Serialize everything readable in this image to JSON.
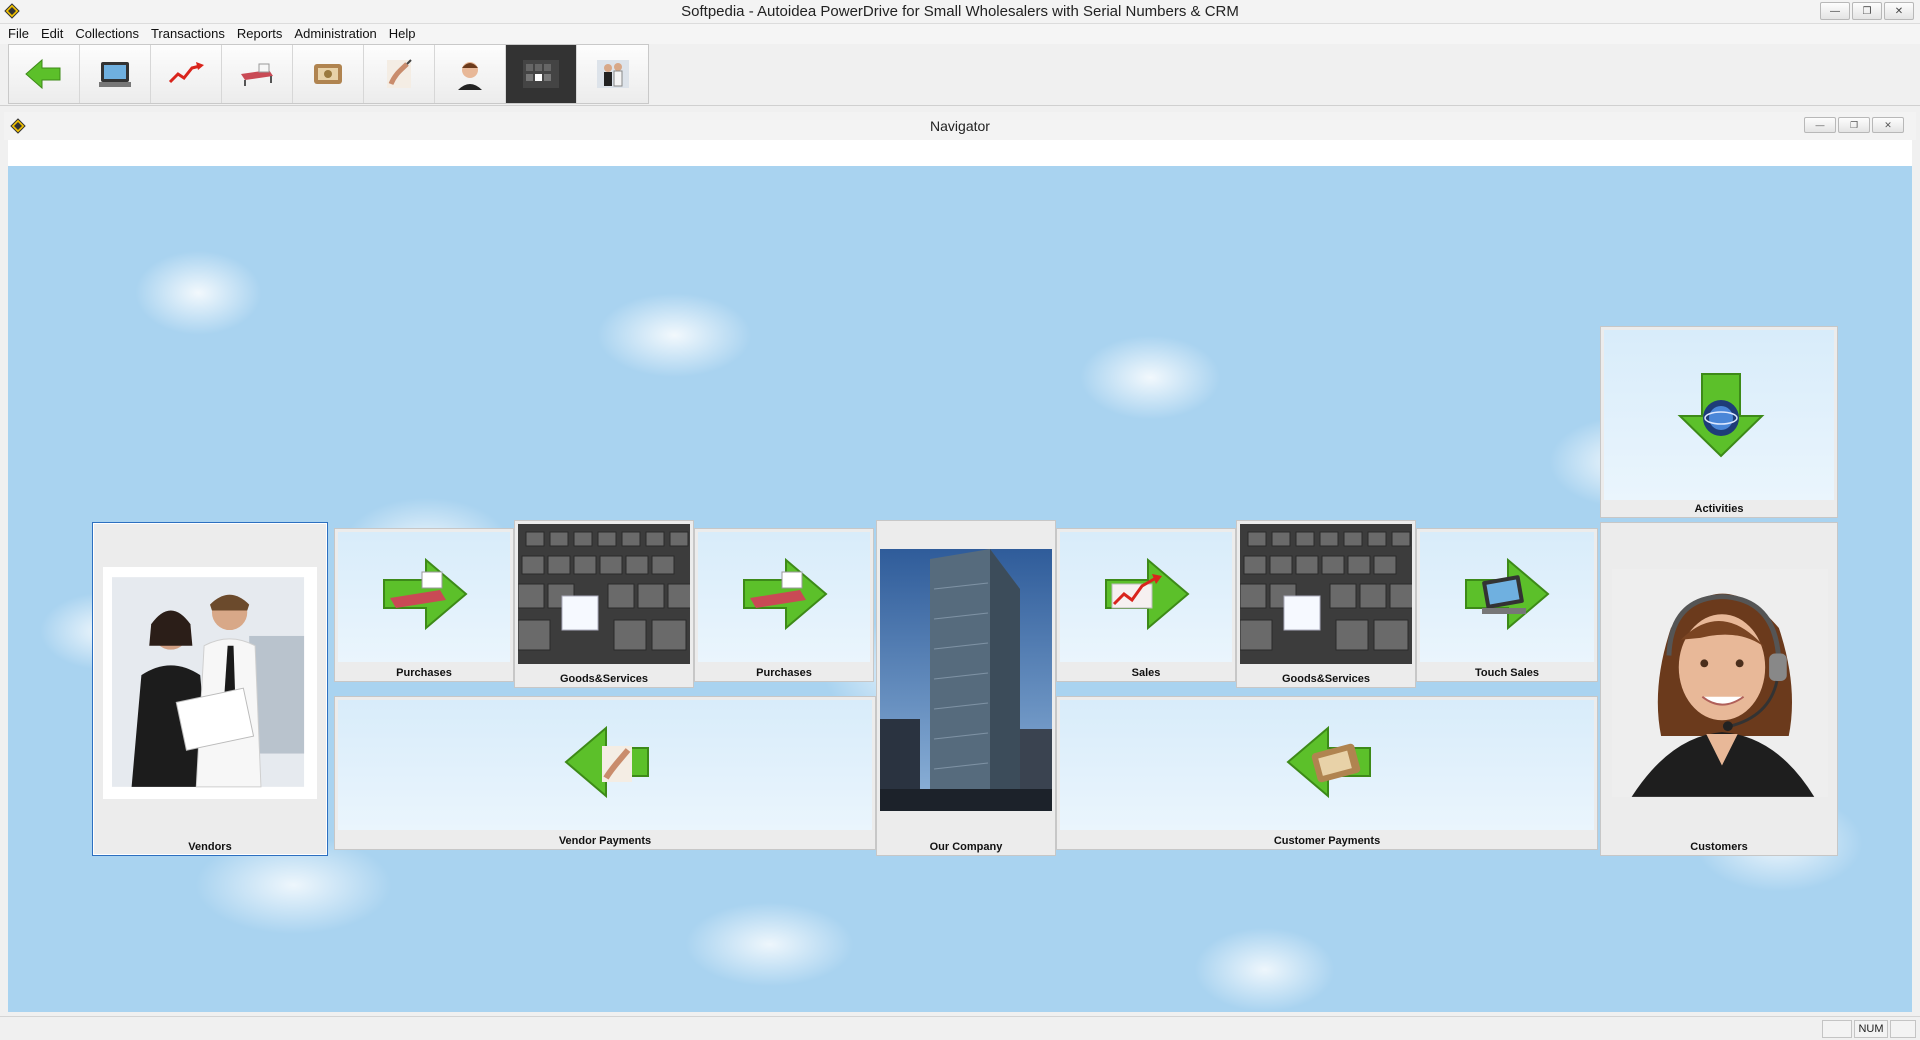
{
  "window": {
    "title": "Softpedia - Autoidea PowerDrive for Small Wholesalers with Serial Numbers & CRM",
    "controls": [
      "minimize",
      "restore",
      "close"
    ]
  },
  "menu": {
    "items": [
      "File",
      "Edit",
      "Collections",
      "Transactions",
      "Reports",
      "Administration",
      "Help"
    ]
  },
  "toolbar": {
    "buttons": [
      {
        "name": "back",
        "icon": "green-arrow-left-icon"
      },
      {
        "name": "touch-sales",
        "icon": "pos-terminal-icon"
      },
      {
        "name": "sales",
        "icon": "sales-chart-icon"
      },
      {
        "name": "purchases",
        "icon": "cart-icon"
      },
      {
        "name": "customer-payments",
        "icon": "money-icon"
      },
      {
        "name": "vendor-payments",
        "icon": "hand-pen-icon"
      },
      {
        "name": "customers",
        "icon": "support-agent-icon"
      },
      {
        "name": "goods-services",
        "icon": "cubes-icon"
      },
      {
        "name": "vendors",
        "icon": "business-people-icon"
      }
    ]
  },
  "navigator": {
    "title": "Navigator",
    "tiles": {
      "vendors": "Vendors",
      "purchases_1": "Purchases",
      "goods_1": "Goods&Services",
      "purchases_2": "Purchases",
      "our_company": "Our Company",
      "sales": "Sales",
      "goods_2": "Goods&Services",
      "touch_sales": "Touch Sales",
      "activities": "Activities",
      "vendor_payments": "Vendor Payments",
      "customer_payments": "Customer Payments",
      "customers": "Customers"
    }
  },
  "statusbar": {
    "num": "NUM"
  },
  "colors": {
    "sky": "#a9d3f0",
    "arrow_green": "#5cc02a",
    "selection": "#2c6fc0"
  }
}
